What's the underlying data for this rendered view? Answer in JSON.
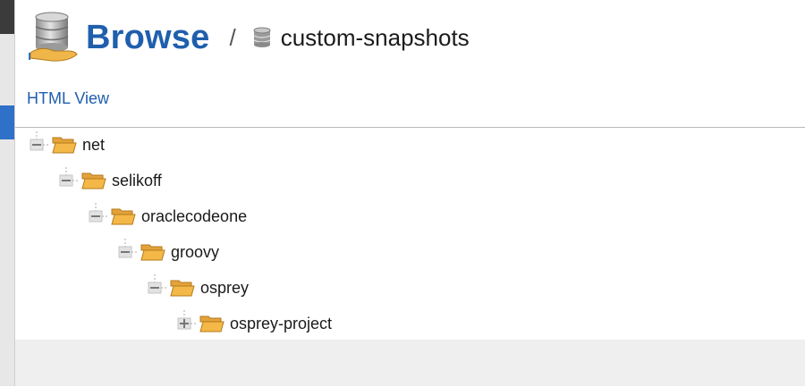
{
  "header": {
    "title": "Browse",
    "separator": "/",
    "repository": "custom-snapshots",
    "title_icon": "database-hand-icon",
    "repository_icon": "database-icon"
  },
  "view_link": "HTML View",
  "tree": {
    "nodes": [
      {
        "label": "net",
        "depth": 0,
        "state": "expanded"
      },
      {
        "label": "selikoff",
        "depth": 1,
        "state": "expanded"
      },
      {
        "label": "oraclecodeone",
        "depth": 2,
        "state": "expanded"
      },
      {
        "label": "groovy",
        "depth": 3,
        "state": "expanded"
      },
      {
        "label": "osprey",
        "depth": 4,
        "state": "expanded"
      },
      {
        "label": "osprey-project",
        "depth": 5,
        "state": "collapsed"
      }
    ]
  },
  "colors": {
    "accent": "#1f5fad",
    "folder": "#f3b847",
    "sidebar_active": "#2f70c9"
  }
}
